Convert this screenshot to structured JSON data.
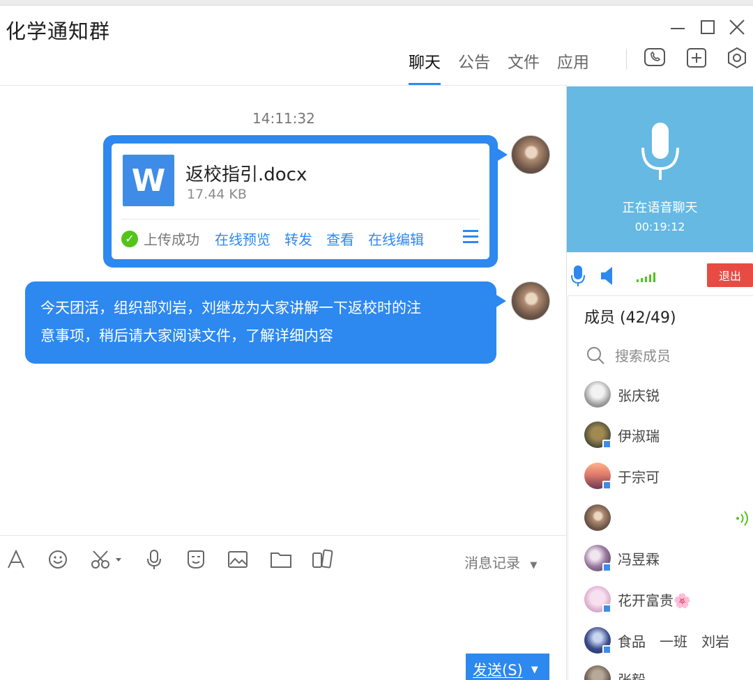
{
  "window": {
    "title": "化学通知群"
  },
  "tabs": [
    {
      "label": "聊天"
    },
    {
      "label": "公告"
    },
    {
      "label": "文件"
    },
    {
      "label": "应用"
    }
  ],
  "chat": {
    "timestamp": "14:11:32",
    "file_message": {
      "file_name": "返校指引.docx",
      "file_size": "17.44 KB",
      "status": "上传成功",
      "actions": [
        "在线预览",
        "转发",
        "查看",
        "在线编辑"
      ]
    },
    "text_message": {
      "line1": "今天团活，组织部刘岩，刘继龙为大家讲解一下返校时的注",
      "line2": "意事项，稍后请大家阅读文件，了解详细内容"
    }
  },
  "composer": {
    "history_label": "消息记录",
    "send_label": "发送(S)"
  },
  "voice_call": {
    "status": "正在语音聊天",
    "duration": "00:19:12",
    "exit_label": "退出"
  },
  "members": {
    "title": "成员 (42/49)",
    "search_placeholder": "搜索成员",
    "list": [
      {
        "name": "张庆锐"
      },
      {
        "name": "伊淑瑞"
      },
      {
        "name": "于宗可"
      },
      {
        "name": ""
      },
      {
        "name": "冯昱霖"
      },
      {
        "name": "花开富贵🌸"
      },
      {
        "name": "食品　一班　刘岩"
      },
      {
        "name": "张毅"
      }
    ]
  },
  "colors": {
    "accent": "#2d88ef",
    "voice_panel": "#65b9e3",
    "exit": "#e84b43",
    "success": "#52c41a"
  }
}
